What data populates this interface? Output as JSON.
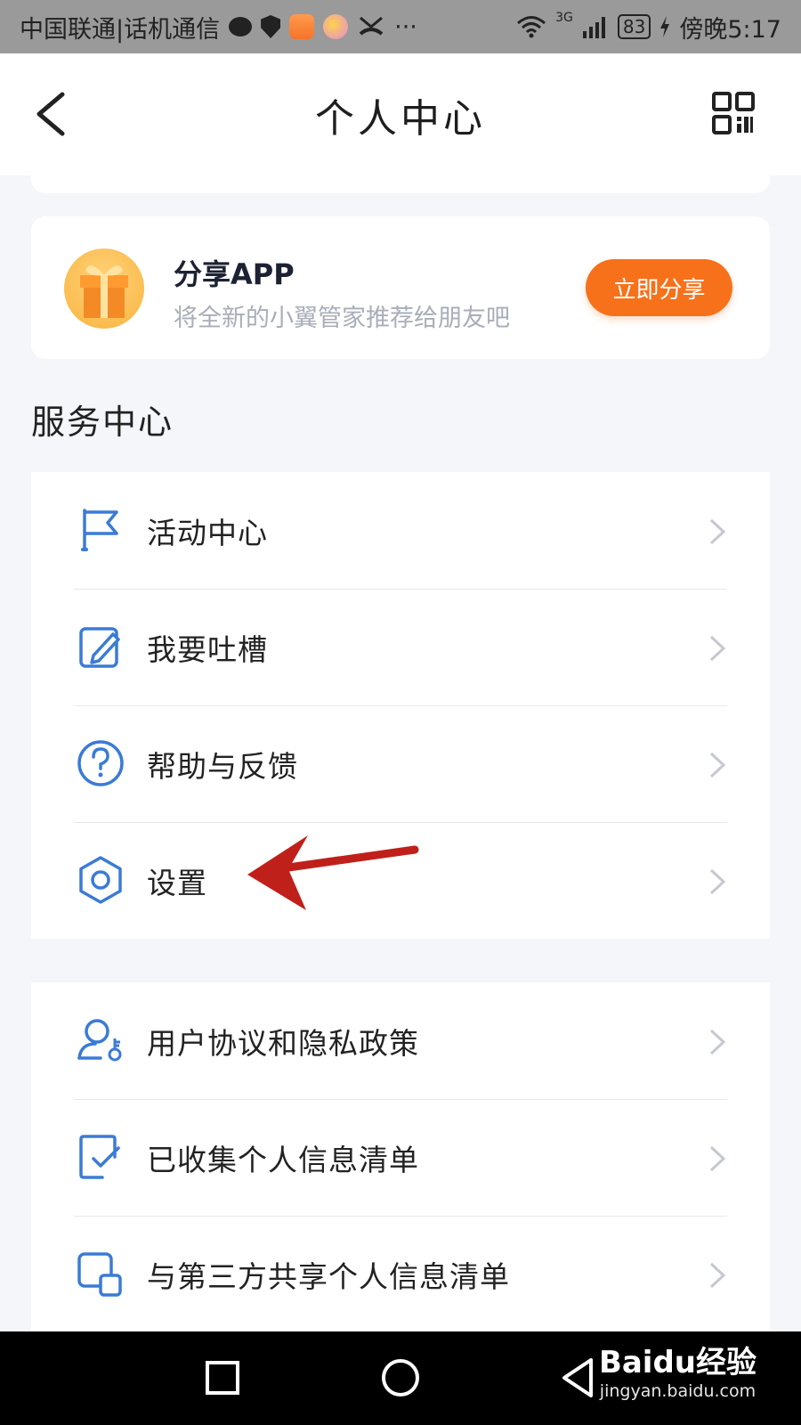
{
  "status_bar": {
    "carrier": "中国联通|话机通信",
    "network": "3G",
    "battery": "83",
    "time": "傍晚5:17",
    "more": "···"
  },
  "header": {
    "title": "个人中心"
  },
  "share_card": {
    "title": "分享APP",
    "subtitle": "将全新的小翼管家推荐给朋友吧",
    "button": "立即分享"
  },
  "service_center": {
    "title": "服务中心",
    "items": [
      {
        "label": "活动中心",
        "icon": "flag-icon"
      },
      {
        "label": "我要吐槽",
        "icon": "edit-note-icon"
      },
      {
        "label": "帮助与反馈",
        "icon": "help-circle-icon"
      },
      {
        "label": "设置",
        "icon": "settings-hexagon-icon"
      }
    ]
  },
  "policy_section": {
    "items": [
      {
        "label": "用户协议和隐私政策",
        "icon": "user-key-icon"
      },
      {
        "label": "已收集个人信息清单",
        "icon": "checklist-icon"
      },
      {
        "label": "与第三方共享个人信息清单",
        "icon": "share-squares-icon"
      }
    ]
  },
  "watermark": {
    "main": "Baidu经验",
    "sub": "jingyan.baidu.com"
  },
  "colors": {
    "accent_blue": "#3a7bd5",
    "share_orange": "#f7711b",
    "annotation_red": "#c0201a",
    "background": "#f4f6fa"
  }
}
